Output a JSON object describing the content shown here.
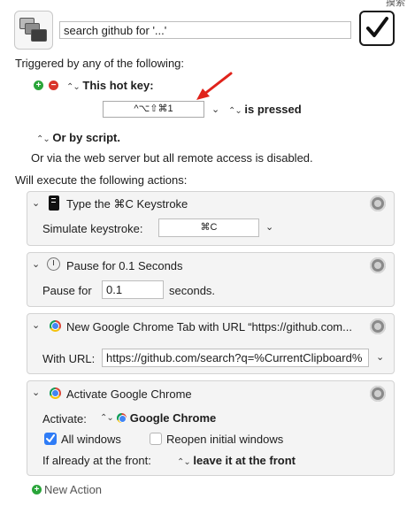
{
  "corner_text": "摸索",
  "macro": {
    "name": "search github for '...'",
    "enabled": true
  },
  "triggers": {
    "header": "Triggered by any of the following:",
    "hot_key": {
      "label": "This hot key:",
      "keys": "^⌥⇧⌘1",
      "condition": "is pressed"
    },
    "script": "Or by script.",
    "web_server": "Or via the web server but all remote access is disabled."
  },
  "actions": {
    "header": "Will execute the following actions:",
    "items": [
      {
        "title": "Type the ⌘C Keystroke",
        "icon": "keyboard-icon",
        "field_label": "Simulate keystroke:",
        "field_value": "⌘C"
      },
      {
        "title": "Pause for 0.1 Seconds",
        "icon": "clock-icon",
        "field_label": "Pause for",
        "field_value": "0.1",
        "field_suffix": "seconds."
      },
      {
        "title": "New Google Chrome Tab with URL “https://github.com...",
        "icon": "chrome-icon",
        "field_label": "With URL:",
        "field_value": "https://github.com/search?q=%CurrentClipboard%"
      },
      {
        "title": "Activate Google Chrome",
        "icon": "chrome-icon",
        "activate_label": "Activate:",
        "activate_app": "Google Chrome",
        "all_windows": {
          "label": "All windows",
          "checked": true
        },
        "reopen": {
          "label": "Reopen initial windows",
          "checked": false
        },
        "front_label": "If already at the front:",
        "front_value": "leave it at the front"
      }
    ]
  },
  "new_action": "New Action",
  "colors": {
    "plus": "#2aa53a",
    "minus": "#d9342b",
    "checkbox_on": "#2f7cf6",
    "arrow": "#e0231b"
  }
}
